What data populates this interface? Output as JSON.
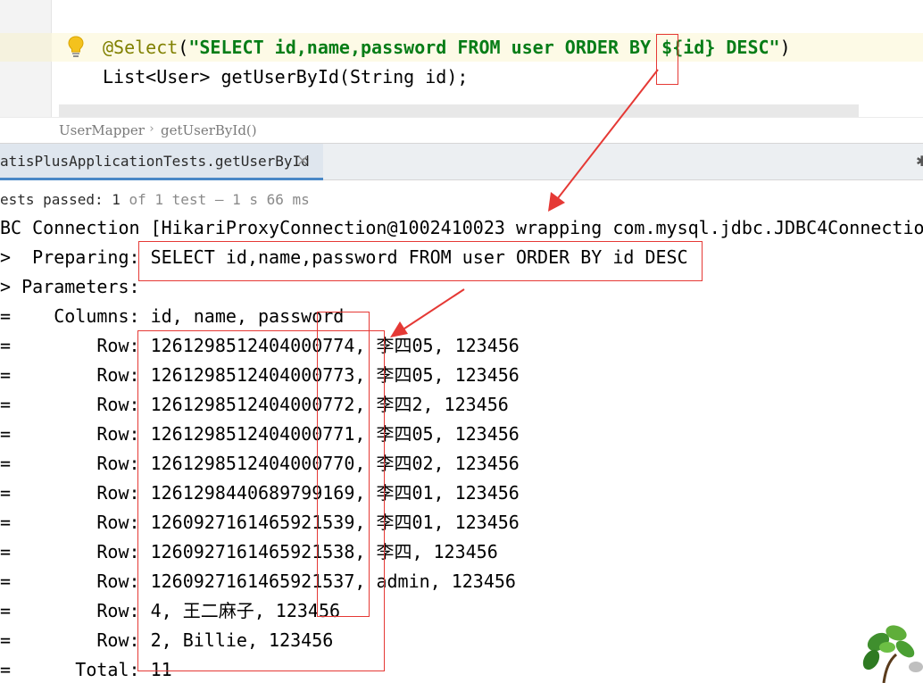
{
  "editor": {
    "line1": {
      "annotation": "@Select",
      "paren_open": "(",
      "string": "\"SELECT id,name,password FROM user ORDER BY ${id} DESC\"",
      "paren_close": ")"
    },
    "line2": "List<User> getUserById(String id);"
  },
  "breadcrumb": {
    "items": [
      "UserMapper",
      "getUserById()"
    ],
    "separator": "›"
  },
  "run_tab": {
    "label": "atisPlusApplicationTests.getUserById",
    "close": "×"
  },
  "status": {
    "prefix": "ests passed: ",
    "passed": "1",
    "of_text": " of 1 test – 1 s 66 ms"
  },
  "console": {
    "connection": "BC Connection [HikariProxyConnection@1002410023 wrapping com.mysql.jdbc.JDBC4Connection",
    "preparing_prefix": ">  Preparing: ",
    "preparing_sql": "SELECT id,name,password FROM user ORDER BY id DESC",
    "parameters": "> Parameters: ",
    "columns_prefix": "=    Columns: ",
    "columns": "id, name, password",
    "row_prefix": "=        Row: ",
    "rows": [
      "1261298512404000774, 李四05, 123456",
      "1261298512404000773, 李四05, 123456",
      "1261298512404000772, 李四2, 123456",
      "1261298512404000771, 李四05, 123456",
      "1261298512404000770, 李四02, 123456",
      "1261298440689799169, 李四01, 123456",
      "1260927161465921539, 李四01, 123456",
      "1260927161465921538, 李四, 123456",
      "1260927161465921537, admin, 123456",
      "4, 王二麻子, 123456",
      "2, Billie, 123456"
    ],
    "total_prefix": "=      Total: ",
    "total": "11"
  },
  "colors": {
    "annotation": "#808000",
    "string": "#067d17",
    "highlight_line": "#fdfae6",
    "tab_active": "#dfe6ee",
    "tab_underline": "#4a88c7",
    "markup_red": "#e53935"
  },
  "icons": {
    "bulb": "lightbulb-icon",
    "close": "close-icon",
    "settings": "gear-icon",
    "plant": "plant-decoration"
  }
}
